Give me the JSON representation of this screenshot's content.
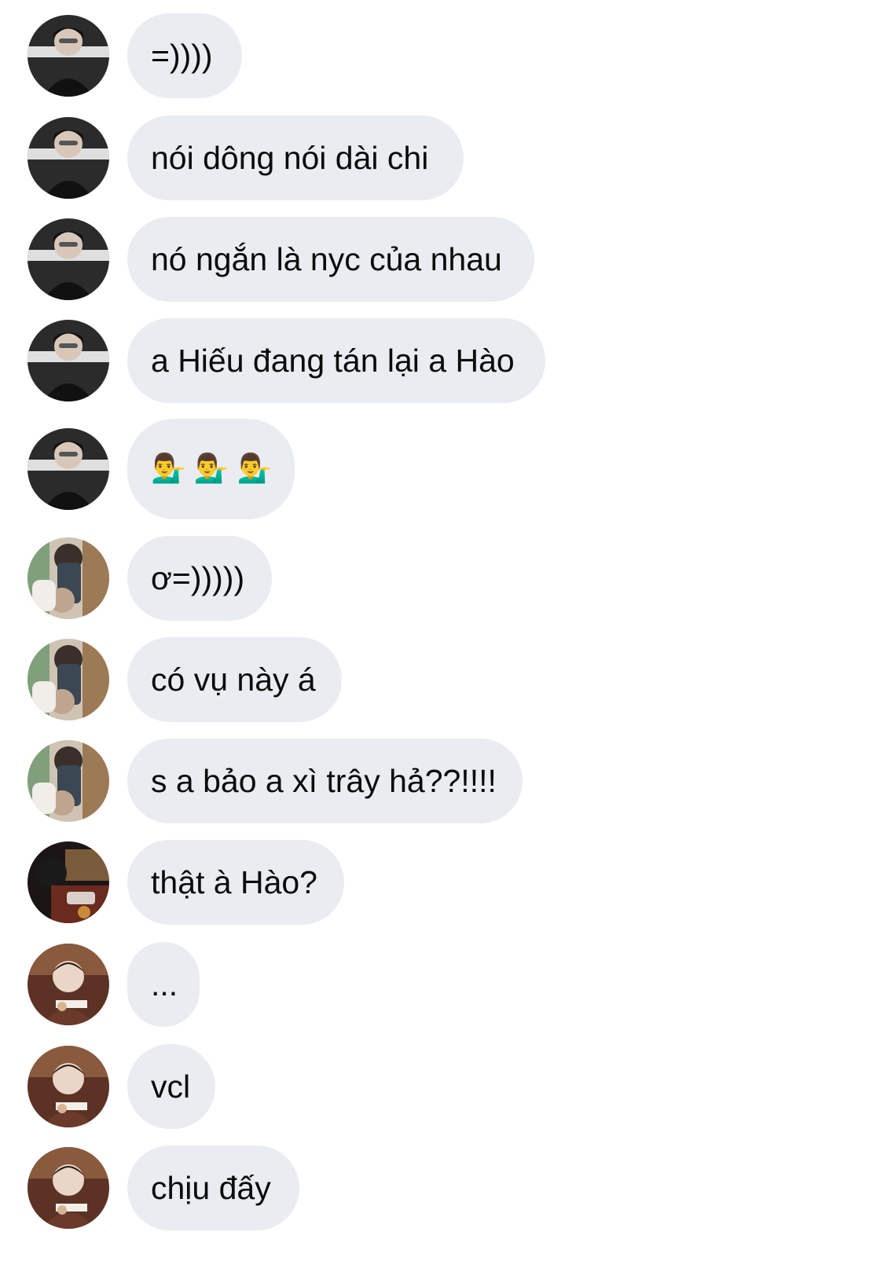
{
  "messages": [
    {
      "avatar": "avatar-user-a",
      "text": "=))))"
    },
    {
      "avatar": "avatar-user-a",
      "text": "nói dông nói dài chi"
    },
    {
      "avatar": "avatar-user-a",
      "text": "nó ngắn là nyc của nhau"
    },
    {
      "avatar": "avatar-user-a",
      "text": "a Hiếu đang tán lại a Hào"
    },
    {
      "avatar": "avatar-user-a",
      "text": "💁‍♂️💁‍♂️💁‍♂️"
    },
    {
      "avatar": "avatar-user-b",
      "text": "ơ=)))))"
    },
    {
      "avatar": "avatar-user-b",
      "text": "có vụ này á"
    },
    {
      "avatar": "avatar-user-b",
      "text": "s a bảo a xì trây hả??!!!!"
    },
    {
      "avatar": "avatar-user-c",
      "text": "thật à Hào?"
    },
    {
      "avatar": "avatar-user-d",
      "text": "..."
    },
    {
      "avatar": "avatar-user-d",
      "text": "vcl"
    },
    {
      "avatar": "avatar-user-d",
      "text": "chịu đấy"
    }
  ],
  "colors": {
    "bubble": "#e9ecf0",
    "text": "#0b0b0b",
    "background": "#ffffff"
  }
}
